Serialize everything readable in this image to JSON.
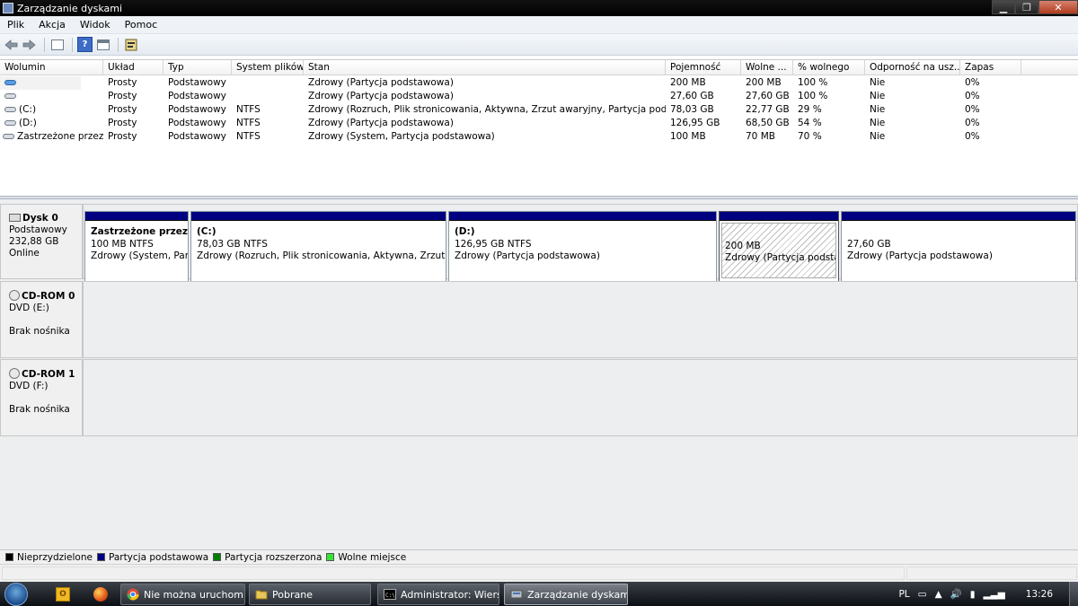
{
  "window": {
    "title": "Zarządzanie dyskami",
    "controls": {
      "minimize": "▁",
      "maximize": "❐",
      "close": "✕"
    }
  },
  "menu": [
    "Plik",
    "Akcja",
    "Widok",
    "Pomoc"
  ],
  "toolbar": {
    "icons": [
      "back-arrow-icon",
      "forward-arrow-icon",
      "console-tree-icon",
      "help-icon",
      "pane-view-icon",
      "properties-icon"
    ],
    "help_glyph": "?"
  },
  "volume_list": {
    "columns": [
      "Wolumin",
      "Układ",
      "Typ",
      "System plików",
      "Stan",
      "Pojemność",
      "Wolne ...",
      "% wolnego",
      "Odporność na usz...",
      "Zapas"
    ],
    "rows": [
      {
        "volume": "",
        "layout": "Prosty",
        "type": "Podstawowy",
        "fs": "",
        "status": "Zdrowy (Partycja podstawowa)",
        "capacity": "200 MB",
        "free": "200 MB",
        "pct": "100 %",
        "fault": "Nie",
        "overhead": "0%"
      },
      {
        "volume": "",
        "layout": "Prosty",
        "type": "Podstawowy",
        "fs": "",
        "status": "Zdrowy (Partycja podstawowa)",
        "capacity": "27,60 GB",
        "free": "27,60 GB",
        "pct": "100 %",
        "fault": "Nie",
        "overhead": "0%"
      },
      {
        "volume": "(C:)",
        "layout": "Prosty",
        "type": "Podstawowy",
        "fs": "NTFS",
        "status": "Zdrowy (Rozruch, Plik stronicowania, Aktywna, Zrzut awaryjny, Partycja podstawo...",
        "capacity": "78,03 GB",
        "free": "22,77 GB",
        "pct": "29 %",
        "fault": "Nie",
        "overhead": "0%"
      },
      {
        "volume": "(D:)",
        "layout": "Prosty",
        "type": "Podstawowy",
        "fs": "NTFS",
        "status": "Zdrowy (Partycja podstawowa)",
        "capacity": "126,95 GB",
        "free": "68,50 GB",
        "pct": "54 %",
        "fault": "Nie",
        "overhead": "0%"
      },
      {
        "volume": "Zastrzeżone przez ...",
        "layout": "Prosty",
        "type": "Podstawowy",
        "fs": "NTFS",
        "status": "Zdrowy (System, Partycja podstawowa)",
        "capacity": "100 MB",
        "free": "70 MB",
        "pct": "70 %",
        "fault": "Nie",
        "overhead": "0%"
      }
    ]
  },
  "disks": [
    {
      "name": "Dysk 0",
      "lines": [
        "Podstawowy",
        "232,88 GB",
        "Online"
      ],
      "partitions": [
        {
          "title": "Zastrzeżone przez sy:",
          "size": "100 MB NTFS",
          "status": "Zdrowy (System, Party"
        },
        {
          "title": "(C:)",
          "size": "78,03 GB NTFS",
          "status": "Zdrowy (Rozruch, Plik stronicowania, Aktywna, Zrzut awary"
        },
        {
          "title": "(D:)",
          "size": "126,95 GB NTFS",
          "status": "Zdrowy (Partycja podstawowa)"
        },
        {
          "title": "",
          "size": "200 MB",
          "status": "Zdrowy (Partycja podstaw"
        },
        {
          "title": "",
          "size": "27,60 GB",
          "status": "Zdrowy (Partycja podstawowa)"
        }
      ]
    },
    {
      "name": "CD-ROM 0",
      "lines": [
        "DVD (E:)",
        "",
        "Brak nośnika"
      ]
    },
    {
      "name": "CD-ROM 1",
      "lines": [
        "DVD (F:)",
        "",
        "Brak nośnika"
      ]
    }
  ],
  "legend": [
    {
      "label": "Nieprzydzielone",
      "color": "#000000"
    },
    {
      "label": "Partycja podstawowa",
      "color": "#000080"
    },
    {
      "label": "Partycja rozszerzona",
      "color": "#008000"
    },
    {
      "label": "Wolne miejsce",
      "color": "#33e633"
    }
  ],
  "taskbar": {
    "quicklaunch": [
      "outlook-icon",
      "firefox-icon"
    ],
    "tasks": [
      {
        "label": "Nie można uruchom...",
        "icon": "chrome-icon"
      },
      {
        "label": "Pobrane",
        "icon": "folder-icon"
      },
      {
        "label": "Administrator: Wiers...",
        "icon": "cmd-icon"
      },
      {
        "label": "Zarządzanie dyskami",
        "icon": "disk-management-icon"
      }
    ],
    "tray": {
      "lang": "PL",
      "time": "13:26"
    }
  }
}
